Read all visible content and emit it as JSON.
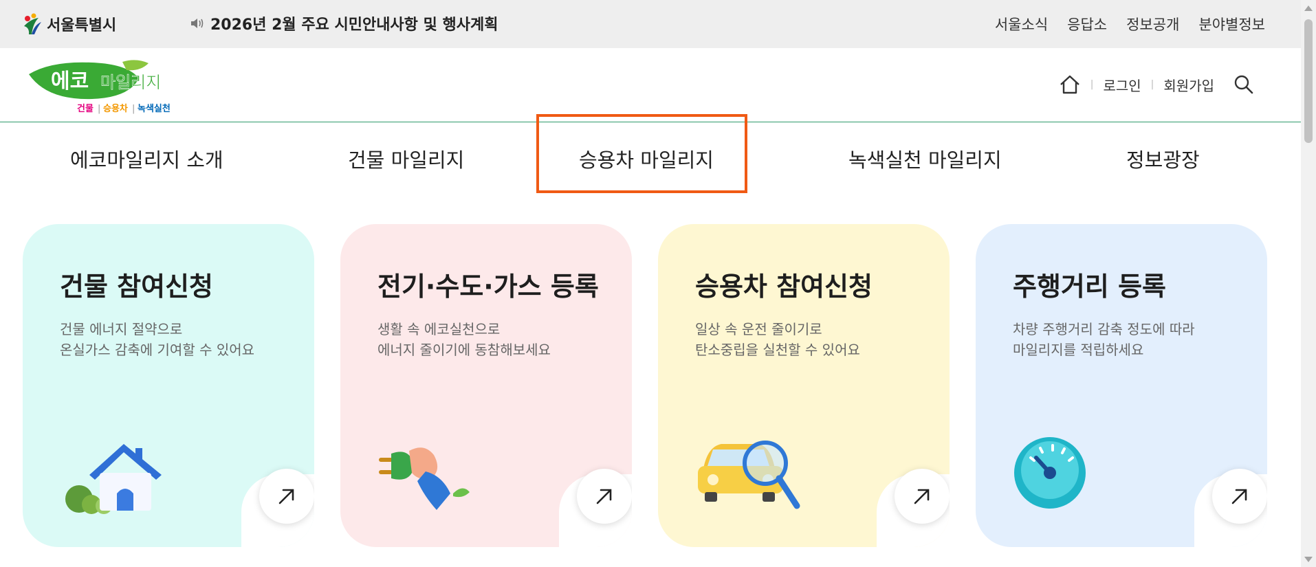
{
  "top_bar": {
    "seoul_logo_text": "서울특별시",
    "notice": "2026년 2월 주요 시민안내사항 및 행사계획",
    "links": [
      "서울소식",
      "응답소",
      "정보공개",
      "분야별정보"
    ]
  },
  "header": {
    "logo_main": "에코",
    "logo_sub": "마일리지",
    "logo_tags": [
      "건물",
      "승용차",
      "녹색실천"
    ],
    "login": "로그인",
    "signup": "회원가입"
  },
  "gnb": {
    "items": [
      "에코마일리지 소개",
      "건물 마일리지",
      "승용차 마일리지",
      "녹색실천 마일리지",
      "정보광장"
    ],
    "highlighted": "승용차 마일리지"
  },
  "cards": [
    {
      "title": "건물 참여신청",
      "desc1": "건물 에너지 절약으로",
      "desc2": "온실가스 감축에 기여할 수 있어요",
      "color": "#dbfaf6",
      "icon": "house-icon"
    },
    {
      "title": "전기·수도·가스 등록",
      "desc1": "생활 속 에코실천으로",
      "desc2": "에너지 줄이기에 동참해보세요",
      "color": "#fde9ea",
      "icon": "plug-hand-icon"
    },
    {
      "title": "승용차 참여신청",
      "desc1": "일상 속 운전 줄이기로",
      "desc2": "탄소중립을 실천할 수 있어요",
      "color": "#fef7d2",
      "icon": "car-magnifier-icon"
    },
    {
      "title": "주행거리 등록",
      "desc1": "차량 주행거리 감축 정도에 따라",
      "desc2": "마일리지를 적립하세요",
      "color": "#e3effd",
      "icon": "speedometer-icon"
    }
  ],
  "colors": {
    "accent_border": "#f05a14",
    "header_line": "#2e9b6a",
    "logo_green": "#3aaa35"
  }
}
